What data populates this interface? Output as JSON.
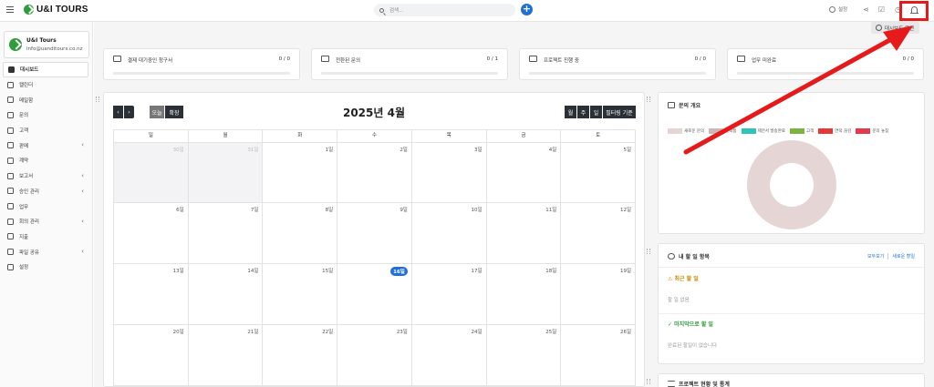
{
  "app": {
    "brand": "U&I TOURS"
  },
  "header": {
    "search_placeholder": "검색...",
    "settings_label": "설정"
  },
  "company": {
    "name": "U&I Tours",
    "email": "info@uanditours.co.nz"
  },
  "sidebar": {
    "items": [
      {
        "label": "대시보드",
        "icon": "dashboard-icon",
        "active": true,
        "chevron": false
      },
      {
        "label": "캘린더",
        "icon": "calendar-icon",
        "active": false,
        "chevron": false
      },
      {
        "label": "메일함",
        "icon": "mail-icon",
        "active": false,
        "chevron": false
      },
      {
        "label": "문의",
        "icon": "inquiry-icon",
        "active": false,
        "chevron": false
      },
      {
        "label": "고객",
        "icon": "customer-icon",
        "active": false,
        "chevron": false
      },
      {
        "label": "판매",
        "icon": "sales-icon",
        "active": false,
        "chevron": true
      },
      {
        "label": "계약",
        "icon": "contract-icon",
        "active": false,
        "chevron": false
      },
      {
        "label": "보고서",
        "icon": "report-icon",
        "active": false,
        "chevron": true
      },
      {
        "label": "승인 관리",
        "icon": "approval-icon",
        "active": false,
        "chevron": true
      },
      {
        "label": "업무",
        "icon": "task-icon",
        "active": false,
        "chevron": false
      },
      {
        "label": "회의 관리",
        "icon": "meeting-icon",
        "active": false,
        "chevron": true
      },
      {
        "label": "지출",
        "icon": "expense-icon",
        "active": false,
        "chevron": false
      },
      {
        "label": "파일 공유",
        "icon": "folder-icon",
        "active": false,
        "chevron": true
      },
      {
        "label": "설정",
        "icon": "settings-icon",
        "active": false,
        "chevron": false
      }
    ]
  },
  "dashboard": {
    "options_label": "대시보드 옵션",
    "stats": [
      {
        "label": "결제 대기중인 청구서",
        "value": "0 / 0",
        "icon": "invoice-icon"
      },
      {
        "label": "전환된 문의",
        "value": "0 / 1",
        "icon": "trend-icon"
      },
      {
        "label": "프로젝트 진행 중",
        "value": "0 / 0",
        "icon": "project-icon"
      },
      {
        "label": "업무 미완료",
        "value": "0 / 0",
        "icon": "file-icon"
      }
    ]
  },
  "calendar": {
    "title": "2025년 4월",
    "today_btn": "오늘",
    "confirm_btn": "확장",
    "view_month": "월",
    "view_week": "주",
    "view_day": "일",
    "filter_btn": "필터링 기준",
    "weekdays": [
      "일",
      "월",
      "화",
      "수",
      "목",
      "금",
      "토"
    ],
    "weeks": [
      [
        "30일",
        "31일",
        "1일",
        "2일",
        "3일",
        "4일",
        "5일"
      ],
      [
        "6일",
        "7일",
        "8일",
        "9일",
        "10일",
        "11일",
        "12일"
      ],
      [
        "13일",
        "14일",
        "15일",
        "16일",
        "17일",
        "18일",
        "19일"
      ],
      [
        "20일",
        "21일",
        "22일",
        "23일",
        "24일",
        "25일",
        "26일"
      ]
    ]
  },
  "inquiry_overview": {
    "title": "문의 개요",
    "legend": [
      {
        "label": "새로운 문의",
        "color": "#e6d5d5"
      },
      {
        "label": "연락됨",
        "color": "#c9b8b8"
      },
      {
        "label": "제안서 발송완료",
        "color": "#2ec4b6"
      },
      {
        "label": "고객",
        "color": "#7cb342"
      },
      {
        "label": "연락 끊김",
        "color": "#e53935"
      },
      {
        "label": "문의 놓침",
        "color": "#e53950"
      }
    ]
  },
  "todo": {
    "title": "내 할 일 항목",
    "view_all": "모두보기",
    "new_todo": "새로운 할일",
    "recent_heading": "최근 할 일",
    "recent_empty": "할 일 없음",
    "done_heading": "마지막으로 할 일",
    "done_empty": "완료된 할일이 없습니다"
  },
  "project_stats": {
    "title": "프로젝트 현황 및 통계"
  }
}
